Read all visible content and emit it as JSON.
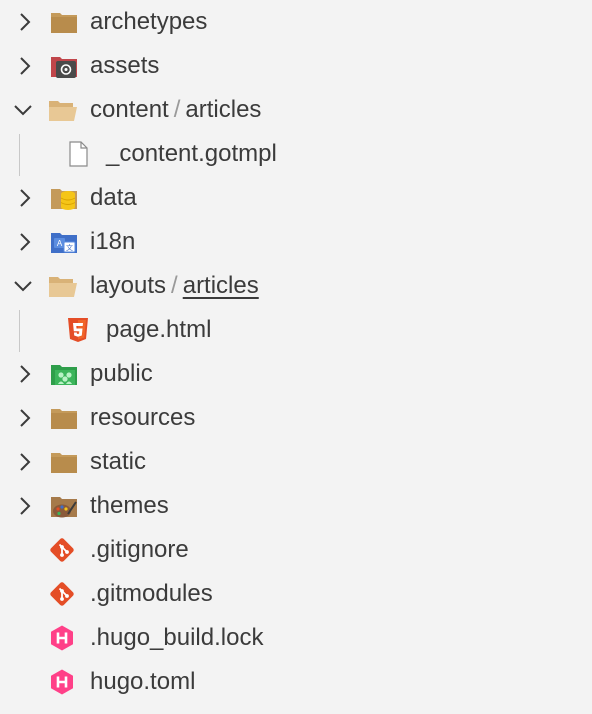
{
  "explorer": {
    "items": [
      {
        "label": "archetypes",
        "icon": "folder-icon",
        "expanded": false
      },
      {
        "label": "assets",
        "icon": "assets-folder-icon",
        "expanded": false
      },
      {
        "label": "content",
        "sub": "articles",
        "icon": "folder-open-icon",
        "expanded": true
      },
      {
        "label": "_content.gotmpl",
        "icon": "file-icon"
      },
      {
        "label": "data",
        "icon": "data-folder-icon",
        "expanded": false
      },
      {
        "label": "i18n",
        "icon": "i18n-folder-icon",
        "expanded": false
      },
      {
        "label": "layouts",
        "sub": "articles",
        "icon": "folder-open-icon",
        "expanded": true
      },
      {
        "label": "page.html",
        "icon": "html5-icon"
      },
      {
        "label": "public",
        "icon": "public-folder-icon",
        "expanded": false
      },
      {
        "label": "resources",
        "icon": "folder-icon",
        "expanded": false
      },
      {
        "label": "static",
        "icon": "folder-icon",
        "expanded": false
      },
      {
        "label": "themes",
        "icon": "themes-folder-icon",
        "expanded": false
      },
      {
        "label": ".gitignore",
        "icon": "git-icon"
      },
      {
        "label": ".gitmodules",
        "icon": "git-icon"
      },
      {
        "label": ".hugo_build.lock",
        "icon": "hugo-icon"
      },
      {
        "label": "hugo.toml",
        "icon": "hugo-icon"
      }
    ]
  },
  "colors": {
    "background": "#f3f3f3",
    "text": "#3b3b3b",
    "folder": "#c49a5a",
    "git": "#e44d26",
    "hugo": "#ff4088",
    "html5": "#e44d26"
  }
}
